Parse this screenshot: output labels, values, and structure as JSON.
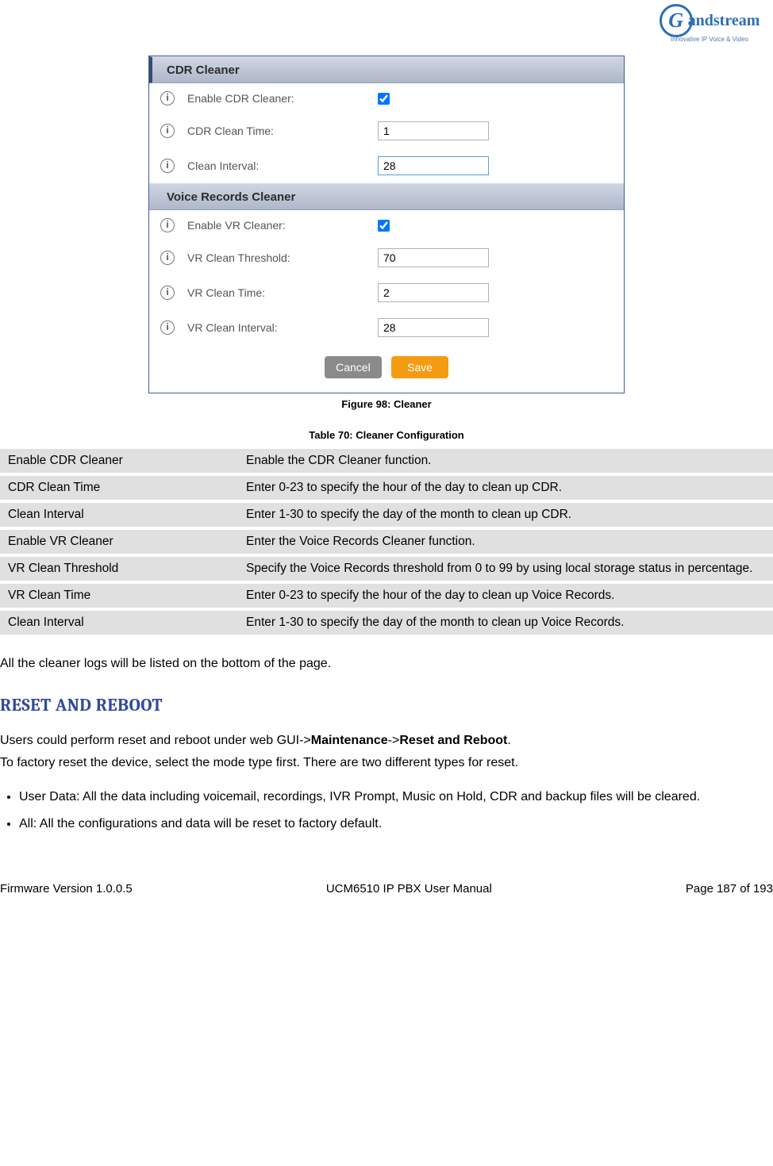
{
  "logo": {
    "brand": "andstream",
    "initial": "G",
    "tagline": "Innovative IP Voice & Video"
  },
  "panel": {
    "section1_title": "CDR Cleaner",
    "section2_title": "Voice Records Cleaner",
    "rows": {
      "enable_cdr_label": "Enable CDR Cleaner:",
      "cdr_time_label": "CDR Clean Time:",
      "cdr_time_value": "1",
      "clean_interval_label": "Clean Interval:",
      "clean_interval_value": "28",
      "enable_vr_label": "Enable VR Cleaner:",
      "vr_threshold_label": "VR Clean Threshold:",
      "vr_threshold_value": "70",
      "vr_time_label": "VR Clean Time:",
      "vr_time_value": "2",
      "vr_interval_label": "VR Clean Interval:",
      "vr_interval_value": "28"
    },
    "cancel": "Cancel",
    "save": "Save"
  },
  "figure_caption": "Figure 98: Cleaner",
  "table_caption": "Table 70: Cleaner Configuration",
  "table": [
    {
      "k": "Enable CDR Cleaner",
      "v": "Enable the CDR Cleaner function."
    },
    {
      "k": "CDR Clean Time",
      "v": "Enter 0-23 to specify the hour of the day to clean up CDR."
    },
    {
      "k": "Clean Interval",
      "v": "Enter 1-30 to specify the day of the month to clean up CDR."
    },
    {
      "k": "Enable VR Cleaner",
      "v": "Enter the Voice Records Cleaner function."
    },
    {
      "k": "VR Clean Threshold",
      "v": "Specify the Voice Records threshold from 0 to 99 by using local storage status in percentage."
    },
    {
      "k": "VR Clean Time",
      "v": "Enter 0-23 to specify the hour of the day to clean up Voice Records."
    },
    {
      "k": "Clean Interval",
      "v": "Enter 1-30 to specify the day of the month to clean up Voice Records."
    }
  ],
  "note": "All the cleaner logs will be listed on the bottom of the page.",
  "heading_reset": "RESET AND REBOOT",
  "reset_p1_a": "Users could perform reset and reboot under web GUI->",
  "reset_p1_b": "Maintenance",
  "reset_p1_c": "->",
  "reset_p1_d": "Reset and Reboot",
  "reset_p1_e": ".",
  "reset_p2": "To factory reset the device, select the mode type first. There are two different types for reset.",
  "bullets": [
    "User Data: All the data including voicemail, recordings, IVR Prompt, Music on Hold, CDR and backup files will be cleared.",
    "All: All the configurations and data will be reset to factory default."
  ],
  "footer": {
    "left": "Firmware Version 1.0.0.5",
    "center": "UCM6510 IP PBX User Manual",
    "right": "Page 187 of 193"
  }
}
